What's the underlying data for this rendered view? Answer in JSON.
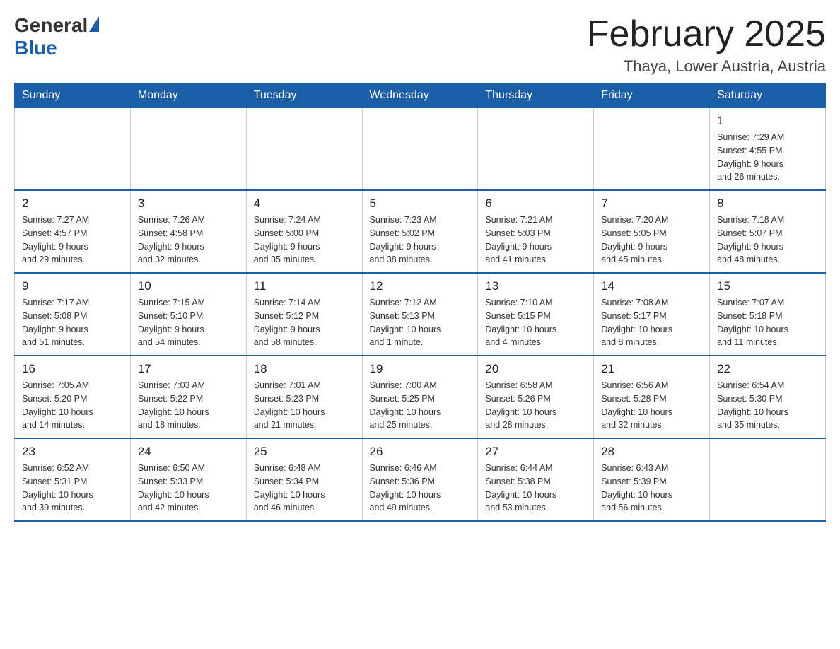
{
  "header": {
    "logo_general": "General",
    "logo_blue": "Blue",
    "month_title": "February 2025",
    "location": "Thaya, Lower Austria, Austria"
  },
  "days_of_week": [
    "Sunday",
    "Monday",
    "Tuesday",
    "Wednesday",
    "Thursday",
    "Friday",
    "Saturday"
  ],
  "weeks": [
    [
      {
        "day": "",
        "info": ""
      },
      {
        "day": "",
        "info": ""
      },
      {
        "day": "",
        "info": ""
      },
      {
        "day": "",
        "info": ""
      },
      {
        "day": "",
        "info": ""
      },
      {
        "day": "",
        "info": ""
      },
      {
        "day": "1",
        "info": "Sunrise: 7:29 AM\nSunset: 4:55 PM\nDaylight: 9 hours\nand 26 minutes."
      }
    ],
    [
      {
        "day": "2",
        "info": "Sunrise: 7:27 AM\nSunset: 4:57 PM\nDaylight: 9 hours\nand 29 minutes."
      },
      {
        "day": "3",
        "info": "Sunrise: 7:26 AM\nSunset: 4:58 PM\nDaylight: 9 hours\nand 32 minutes."
      },
      {
        "day": "4",
        "info": "Sunrise: 7:24 AM\nSunset: 5:00 PM\nDaylight: 9 hours\nand 35 minutes."
      },
      {
        "day": "5",
        "info": "Sunrise: 7:23 AM\nSunset: 5:02 PM\nDaylight: 9 hours\nand 38 minutes."
      },
      {
        "day": "6",
        "info": "Sunrise: 7:21 AM\nSunset: 5:03 PM\nDaylight: 9 hours\nand 41 minutes."
      },
      {
        "day": "7",
        "info": "Sunrise: 7:20 AM\nSunset: 5:05 PM\nDaylight: 9 hours\nand 45 minutes."
      },
      {
        "day": "8",
        "info": "Sunrise: 7:18 AM\nSunset: 5:07 PM\nDaylight: 9 hours\nand 48 minutes."
      }
    ],
    [
      {
        "day": "9",
        "info": "Sunrise: 7:17 AM\nSunset: 5:08 PM\nDaylight: 9 hours\nand 51 minutes."
      },
      {
        "day": "10",
        "info": "Sunrise: 7:15 AM\nSunset: 5:10 PM\nDaylight: 9 hours\nand 54 minutes."
      },
      {
        "day": "11",
        "info": "Sunrise: 7:14 AM\nSunset: 5:12 PM\nDaylight: 9 hours\nand 58 minutes."
      },
      {
        "day": "12",
        "info": "Sunrise: 7:12 AM\nSunset: 5:13 PM\nDaylight: 10 hours\nand 1 minute."
      },
      {
        "day": "13",
        "info": "Sunrise: 7:10 AM\nSunset: 5:15 PM\nDaylight: 10 hours\nand 4 minutes."
      },
      {
        "day": "14",
        "info": "Sunrise: 7:08 AM\nSunset: 5:17 PM\nDaylight: 10 hours\nand 8 minutes."
      },
      {
        "day": "15",
        "info": "Sunrise: 7:07 AM\nSunset: 5:18 PM\nDaylight: 10 hours\nand 11 minutes."
      }
    ],
    [
      {
        "day": "16",
        "info": "Sunrise: 7:05 AM\nSunset: 5:20 PM\nDaylight: 10 hours\nand 14 minutes."
      },
      {
        "day": "17",
        "info": "Sunrise: 7:03 AM\nSunset: 5:22 PM\nDaylight: 10 hours\nand 18 minutes."
      },
      {
        "day": "18",
        "info": "Sunrise: 7:01 AM\nSunset: 5:23 PM\nDaylight: 10 hours\nand 21 minutes."
      },
      {
        "day": "19",
        "info": "Sunrise: 7:00 AM\nSunset: 5:25 PM\nDaylight: 10 hours\nand 25 minutes."
      },
      {
        "day": "20",
        "info": "Sunrise: 6:58 AM\nSunset: 5:26 PM\nDaylight: 10 hours\nand 28 minutes."
      },
      {
        "day": "21",
        "info": "Sunrise: 6:56 AM\nSunset: 5:28 PM\nDaylight: 10 hours\nand 32 minutes."
      },
      {
        "day": "22",
        "info": "Sunrise: 6:54 AM\nSunset: 5:30 PM\nDaylight: 10 hours\nand 35 minutes."
      }
    ],
    [
      {
        "day": "23",
        "info": "Sunrise: 6:52 AM\nSunset: 5:31 PM\nDaylight: 10 hours\nand 39 minutes."
      },
      {
        "day": "24",
        "info": "Sunrise: 6:50 AM\nSunset: 5:33 PM\nDaylight: 10 hours\nand 42 minutes."
      },
      {
        "day": "25",
        "info": "Sunrise: 6:48 AM\nSunset: 5:34 PM\nDaylight: 10 hours\nand 46 minutes."
      },
      {
        "day": "26",
        "info": "Sunrise: 6:46 AM\nSunset: 5:36 PM\nDaylight: 10 hours\nand 49 minutes."
      },
      {
        "day": "27",
        "info": "Sunrise: 6:44 AM\nSunset: 5:38 PM\nDaylight: 10 hours\nand 53 minutes."
      },
      {
        "day": "28",
        "info": "Sunrise: 6:43 AM\nSunset: 5:39 PM\nDaylight: 10 hours\nand 56 minutes."
      },
      {
        "day": "",
        "info": ""
      }
    ]
  ]
}
